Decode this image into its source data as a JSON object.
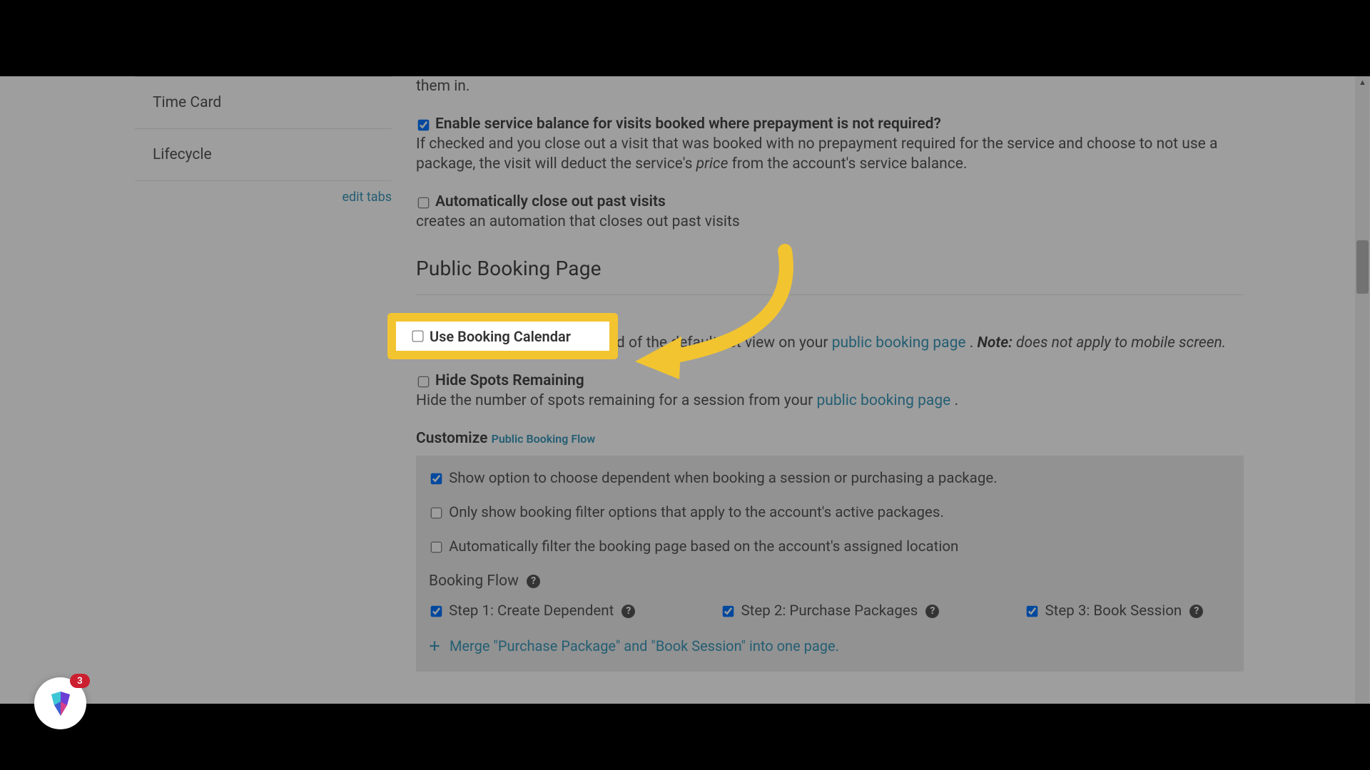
{
  "sidebar": {
    "items": [
      {
        "label": "Time Card"
      },
      {
        "label": "Lifecycle"
      }
    ],
    "edit_tabs_label": "edit tabs"
  },
  "intro_fragment": "them in.",
  "svc_balance": {
    "checked": true,
    "label": "Enable service balance for visits booked where prepayment is not required?",
    "desc_a": "If checked and you close out a visit that was booked with no prepayment required for the service and choose to not use a package, the visit will deduct the service's ",
    "desc_price_word": "price",
    "desc_b": " from the account's service balance."
  },
  "auto_close": {
    "checked": false,
    "label": "Automatically close out past visits",
    "desc": "creates an automation that closes out past visits"
  },
  "public_booking_heading": "Public Booking Page",
  "use_calendar": {
    "checked": false,
    "label": "Use Booking Calendar",
    "desc_a": "Use a monthly calendar instead of the default list view on your ",
    "link": "public booking page",
    "desc_b": " . ",
    "note_label": "Note:",
    "note_text": " does not apply to mobile screen."
  },
  "hide_spots": {
    "checked": false,
    "label": "Hide Spots Remaining",
    "desc_a": "Hide the number of spots remaining for a session from your ",
    "link": "public booking page",
    "desc_b": " ."
  },
  "customize": {
    "title_a": "Customize ",
    "title_link": "Public Booking Flow",
    "opt1": {
      "checked": true,
      "label": "Show option to choose dependent when booking a session or purchasing a package."
    },
    "opt2": {
      "checked": false,
      "label": "Only show booking filter options that apply to the account's active packages."
    },
    "opt3": {
      "checked": false,
      "label": "Automatically filter the booking page based on the account's assigned location"
    },
    "booking_flow_title": "Booking Flow",
    "steps": {
      "s1": {
        "checked": true,
        "label": "Step 1: Create Dependent"
      },
      "s2": {
        "checked": true,
        "label": "Step 2: Purchase Packages"
      },
      "s3": {
        "checked": true,
        "label": "Step 3: Book Session"
      }
    },
    "merge_label": "Merge \"Purchase Package\" and \"Book Session\" into one page."
  },
  "logo_badge": "3"
}
